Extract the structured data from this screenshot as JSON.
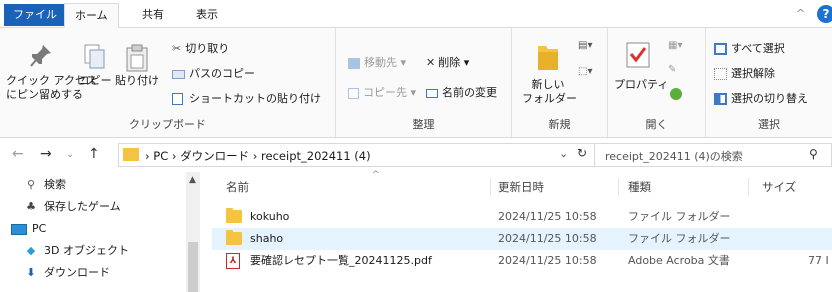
{
  "ribbon_tabs": {
    "file": "ファイル",
    "home": "ホーム",
    "share": "共有",
    "view": "表示"
  },
  "help_label": "?",
  "clipboard": {
    "pin_label_1": "クイック アクセス",
    "pin_label_2": "にピン留めする",
    "copy_label": "コピー",
    "paste_label": "貼り付け",
    "cut_label": "切り取り",
    "copy_path_label": "パスのコピー",
    "paste_shortcut_label": "ショートカットの貼り付け",
    "group_label": "クリップボード"
  },
  "organize": {
    "move_label": "移動先",
    "delete_label": "削除",
    "copy_to_label": "コピー先",
    "rename_label": "名前の変更",
    "group_label": "整理"
  },
  "new_group": {
    "new_folder_1": "新しい",
    "new_folder_2": "フォルダー",
    "group_label": "新規"
  },
  "open_group": {
    "properties_label": "プロパティ",
    "group_label": "開く"
  },
  "select_group": {
    "select_all_label": "すべて選択",
    "select_none_label": "選択解除",
    "invert_label": "選択の切り替え",
    "group_label": "選択"
  },
  "address": {
    "crumbs": "PC  ›  ダウンロード  ›  receipt_202411 (4)",
    "search_placeholder": "receipt_202411 (4)の検索"
  },
  "nav_pane": {
    "items": [
      {
        "label": "検索",
        "icon": "search-icon"
      },
      {
        "label": "保存したゲーム",
        "icon": "saved-games-icon"
      },
      {
        "label": "PC",
        "icon": "pc-icon"
      },
      {
        "label": "3D オブジェクト",
        "icon": "3d-objects-icon"
      },
      {
        "label": "ダウンロード",
        "icon": "download-icon"
      }
    ]
  },
  "columns": {
    "name": "名前",
    "modified": "更新日時",
    "type": "種類",
    "size": "サイズ"
  },
  "files": [
    {
      "name": "kokuho",
      "modified": "2024/11/25 10:58",
      "type": "ファイル フォルダー",
      "size": "",
      "icon": "folder-icon"
    },
    {
      "name": "shaho",
      "modified": "2024/11/25 10:58",
      "type": "ファイル フォルダー",
      "size": "",
      "icon": "folder-icon"
    },
    {
      "name": "要確認レセプト一覧_20241125.pdf",
      "modified": "2024/11/25 10:58",
      "type": "Adobe Acroba 文書",
      "size": "77 I",
      "icon": "pdf-icon"
    }
  ],
  "colors": {
    "accent": "#1a62b8",
    "selection": "#e5f3ff",
    "folder": "#f5c342",
    "pdf": "#c62828"
  }
}
